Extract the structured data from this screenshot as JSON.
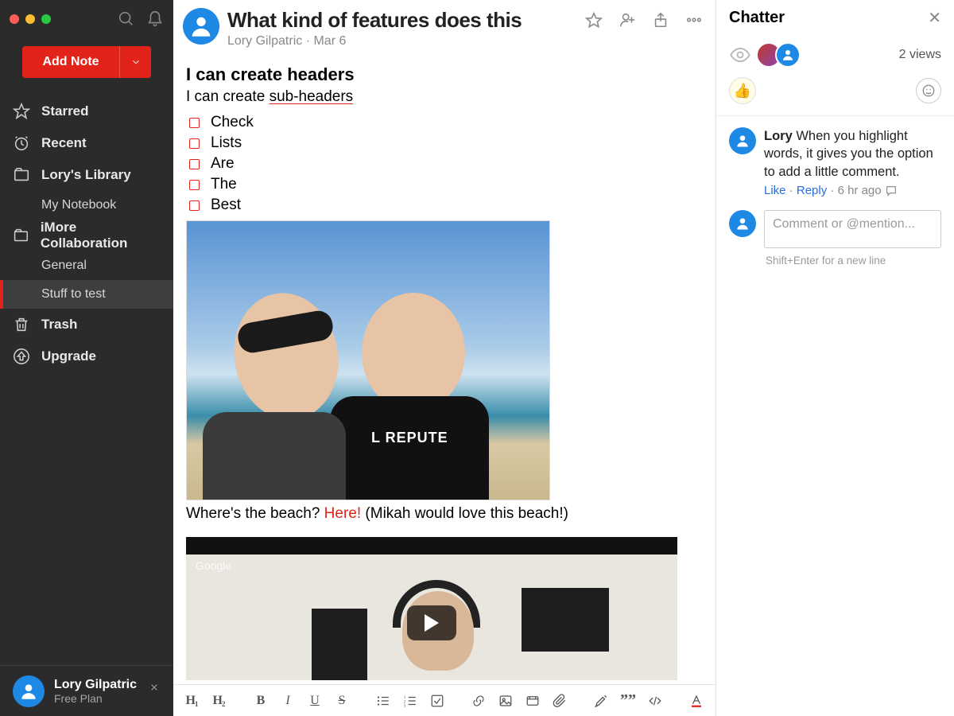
{
  "sidebar": {
    "add_note": "Add Note",
    "items": {
      "starred": "Starred",
      "recent": "Recent",
      "library": "Lory's Library",
      "my_notebook": "My Notebook",
      "collab": "iMore Collaboration",
      "general": "General",
      "stuff": "Stuff to test",
      "trash": "Trash",
      "upgrade": "Upgrade"
    },
    "footer": {
      "name": "Lory Gilpatric",
      "plan": "Free Plan"
    }
  },
  "note": {
    "title": "What kind of features does this",
    "author": "Lory Gilpatric",
    "date": "Mar 6",
    "h2": "I can create headers",
    "sub_prefix": "I can create ",
    "sub_link": "sub-headers",
    "check": [
      "Check",
      "Lists",
      "Are",
      "The",
      "Best"
    ],
    "caption_a": "Where's the beach? ",
    "caption_here": "Here!",
    "caption_b": " (Mikah would love this beach!)",
    "photo_shirt": "L REPUTE",
    "video_watermark": "Google"
  },
  "chatter": {
    "title": "Chatter",
    "views": "2 views",
    "reaction": "👍",
    "comment": {
      "author": "Lory",
      "text": " When you highlight words, it gives you the option to add a little comment.",
      "like": "Like",
      "reply": "Reply",
      "time": "6 hr ago"
    },
    "compose_placeholder": "Comment or @mention...",
    "hint": "Shift+Enter for a new line"
  }
}
